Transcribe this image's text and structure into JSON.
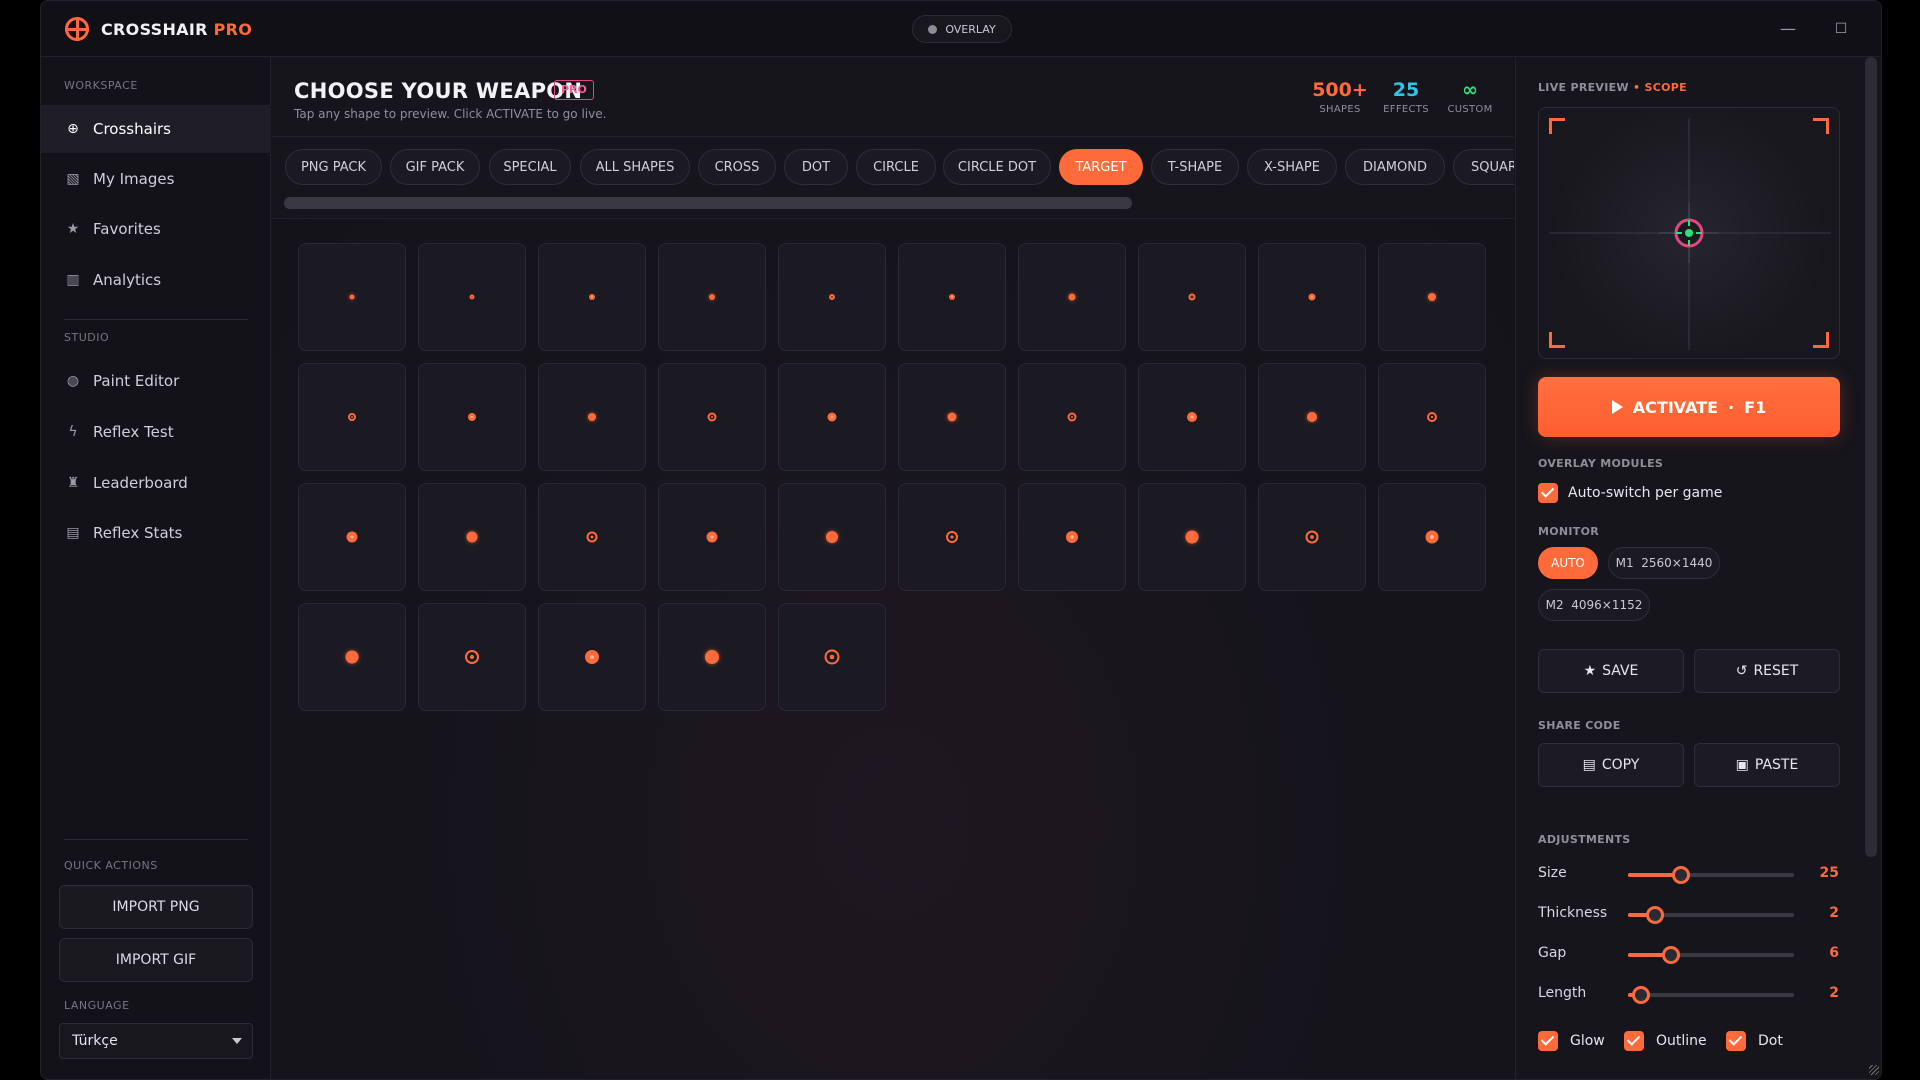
{
  "app": {
    "title_main": "CROSSHAIR",
    "title_accent": "PRO",
    "overlay_label": "OVERLAY",
    "window_controls": {
      "minimize": "—",
      "maximize": "☐",
      "close": "✕"
    }
  },
  "sidebar": {
    "workspace_label": "WORKSPACE",
    "workspace_items": [
      {
        "label": "Crosshairs",
        "icon": "crosshair-icon",
        "active": true
      },
      {
        "label": "My Images",
        "icon": "image-icon"
      },
      {
        "label": "Favorites",
        "icon": "star-icon"
      },
      {
        "label": "Analytics",
        "icon": "bar-chart-icon"
      }
    ],
    "studio_label": "STUDIO",
    "studio_items": [
      {
        "label": "Paint Editor",
        "icon": "palette-icon"
      },
      {
        "label": "Reflex Test",
        "icon": "bolt-icon"
      },
      {
        "label": "Leaderboard",
        "icon": "trophy-icon"
      },
      {
        "label": "Reflex Stats",
        "icon": "stats-icon"
      }
    ],
    "quick_actions_label": "QUICK ACTIONS",
    "import_png": "IMPORT PNG",
    "import_gif": "IMPORT GIF",
    "language_label": "LANGUAGE",
    "language_value": "Türkçe"
  },
  "main": {
    "title": "CHOOSE YOUR WEAPON",
    "badge": "PRO",
    "subtitle": "Tap any shape to preview. Click ACTIVATE to go live.",
    "stats": [
      {
        "value": "500+",
        "label": "SHAPES",
        "color": "#ff6a3a"
      },
      {
        "value": "25",
        "label": "EFFECTS",
        "color": "#2ec6e6"
      },
      {
        "value": "∞",
        "label": "CUSTOM",
        "color": "#2ee07a"
      }
    ],
    "tabs": [
      "PNG PACK",
      "GIF PACK",
      "SPECIAL",
      "ALL SHAPES",
      "CROSS",
      "DOT",
      "CIRCLE",
      "CIRCLE DOT",
      "TARGET",
      "T-SHAPE",
      "X-SHAPE",
      "DIAMOND",
      "SQUAR"
    ],
    "active_tab": "TARGET",
    "shape_count": 35
  },
  "panel": {
    "preview_label": "LIVE PREVIEW",
    "preview_mode": "SCOPE",
    "activate_label": "ACTIVATE",
    "activate_key": "F1",
    "overlay_modules_label": "OVERLAY MODULES",
    "auto_switch_label": "Auto-switch per game",
    "monitor_label": "MONITOR",
    "monitors": [
      {
        "id": "AUTO",
        "res": "",
        "active": true
      },
      {
        "id": "M1",
        "res": "2560×1440"
      },
      {
        "id": "M2",
        "res": "4096×1152"
      }
    ],
    "save_label": "SAVE",
    "reset_label": "RESET",
    "share_code_label": "SHARE CODE",
    "copy_label": "COPY",
    "paste_label": "PASTE",
    "adjustments_label": "ADJUSTMENTS",
    "adjustments": [
      {
        "label": "Size",
        "value": "25",
        "fraction": 0.32
      },
      {
        "label": "Thickness",
        "value": "2",
        "fraction": 0.16
      },
      {
        "label": "Gap",
        "value": "6",
        "fraction": 0.26
      },
      {
        "label": "Length",
        "value": "2",
        "fraction": 0.08
      }
    ],
    "toggles": [
      {
        "label": "Glow",
        "checked": true
      },
      {
        "label": "Outline",
        "checked": true
      },
      {
        "label": "Dot",
        "checked": true
      }
    ]
  },
  "colors": {
    "accent": "#ff6a3a",
    "pink": "#e4457f",
    "cyan": "#2ec6e6",
    "green": "#2ee07a"
  }
}
